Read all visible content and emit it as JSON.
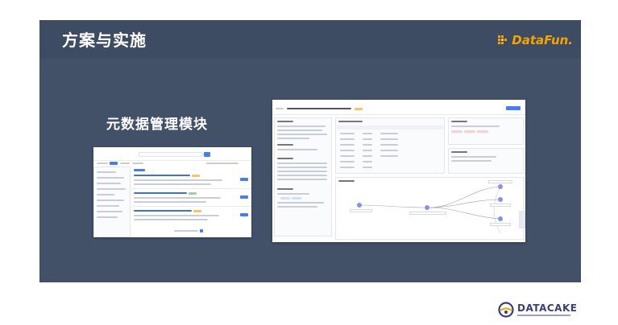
{
  "header": {
    "title": "方案与实施",
    "brand": "DataFun."
  },
  "section": {
    "title": "元数据管理模块"
  },
  "footer": {
    "brand": "DATACAKE"
  },
  "colors": {
    "header_bg": "#3d4c63",
    "body_bg": "#425068",
    "brand_orange": "#f5a300",
    "accent_blue": "#3d6fe0",
    "graph_node": "#8b8fe6",
    "footer_brand": "#3a3f7a"
  },
  "icons": {
    "brand_mark": "datafun-mark-icon",
    "footer_mark": "datacake-mark-icon"
  }
}
